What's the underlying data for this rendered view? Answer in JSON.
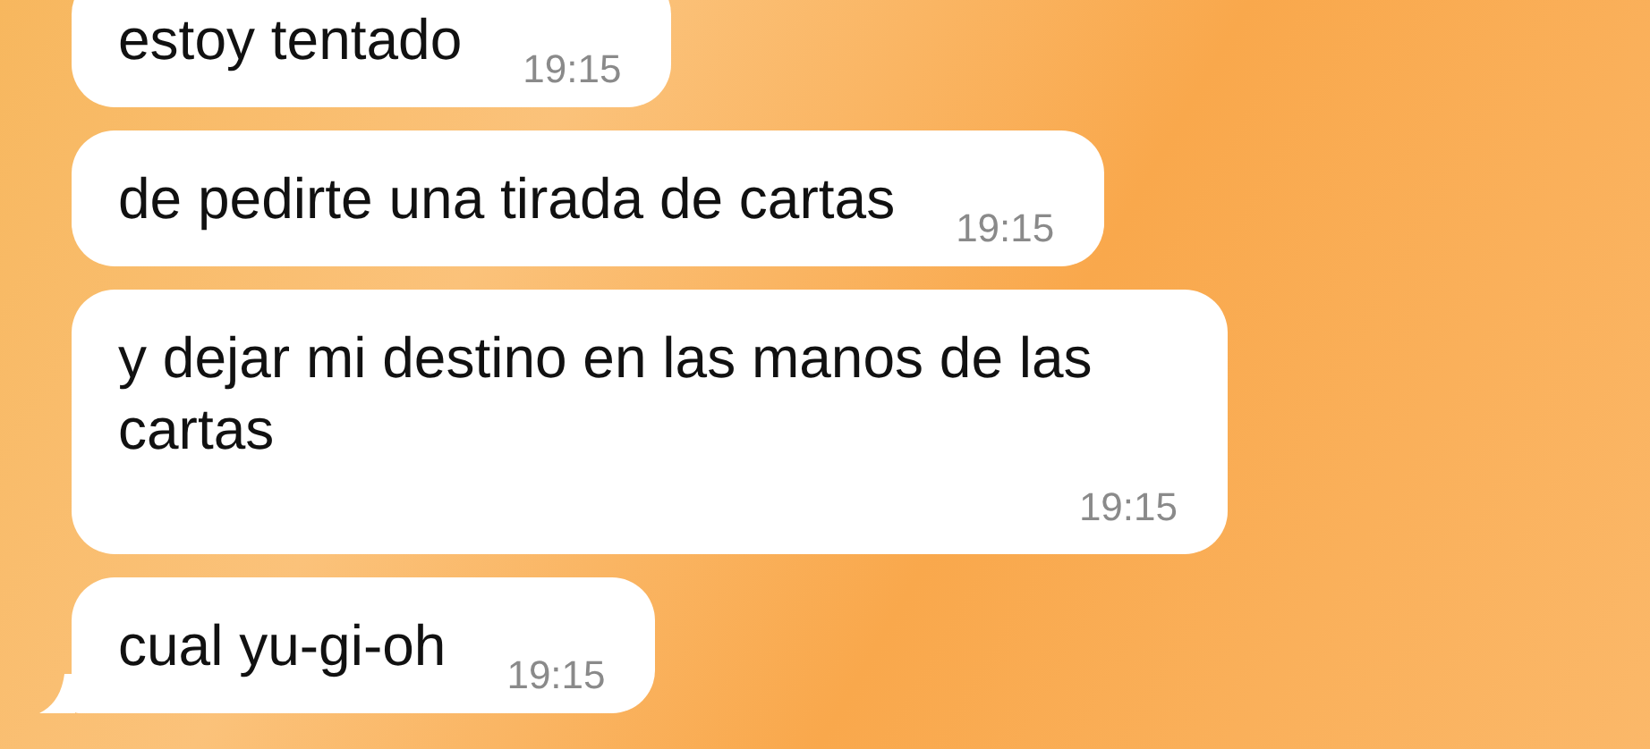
{
  "messages": [
    {
      "kind": "single",
      "text": "estoy tentado",
      "time": "19:15",
      "tail": false
    },
    {
      "kind": "single",
      "text": "de pedirte una tirada de cartas",
      "time": "19:15",
      "tail": false
    },
    {
      "kind": "multiline",
      "text": "y dejar mi destino en las manos de las cartas",
      "time": "19:15",
      "tail": false
    },
    {
      "kind": "single",
      "text": "cual yu-gi-oh",
      "time": "19:15",
      "tail": true
    }
  ]
}
